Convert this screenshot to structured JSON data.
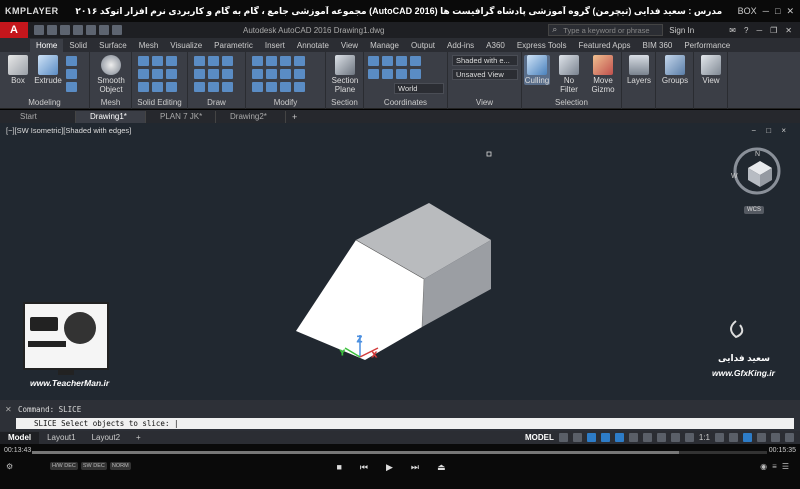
{
  "player": {
    "logo": "KMPLAYER",
    "title": "مجموعه آموزشی جامع ، گام به گام و کاربردی نرم افزار اتوکد ۲۰۱۶ (AutoCAD 2016)  مدرس : سعید فدایی (تیچرمن) گروه آموزشی پادشاه گرافیست ها",
    "right_label": "BOX",
    "time_elapsed": "00:13:43",
    "time_total": "00:15:35",
    "progress_fraction": 0.88,
    "badges": [
      "H/W DEC",
      "SW DEC",
      "NORM"
    ]
  },
  "acad": {
    "logo": "A",
    "filename": "Autodesk AutoCAD 2016    Drawing1.dwg",
    "search_placeholder": "Type a keyword or phrase",
    "signin": "Sign In"
  },
  "ribbon_tabs": [
    "Home",
    "Solid",
    "Surface",
    "Mesh",
    "Visualize",
    "Parametric",
    "Insert",
    "Annotate",
    "View",
    "Manage",
    "Output",
    "Add-ins",
    "A360",
    "Express Tools",
    "Featured Apps",
    "BIM 360",
    "Performance"
  ],
  "ribbon": {
    "panels": {
      "modeling": "Modeling",
      "mesh": "Mesh",
      "solid_editing": "Solid Editing",
      "draw": "Draw",
      "modify": "Modify",
      "section": "Section",
      "coordinates": "Coordinates",
      "view": "View",
      "selection": "Selection"
    },
    "buttons": {
      "box": "Box",
      "extrude": "Extrude",
      "smooth_object": "Smooth Object",
      "section_plane": "Section Plane",
      "culling": "Culling",
      "no_filter": "No Filter",
      "move_gizmo": "Move Gizmo",
      "layers": "Layers",
      "groups": "Groups",
      "view": "View"
    },
    "dropdowns": {
      "visual_style": "Shaded with e...",
      "saved_view": "Unsaved View",
      "ucs": "World"
    }
  },
  "file_tabs": [
    "Start",
    "Drawing1*",
    "PLAN 7 JK*",
    "Drawing2*"
  ],
  "viewport": {
    "label": "[−][SW Isometric][Shaded with edges]",
    "ctrls": "− □ ×",
    "viewcube_text": "WCS",
    "watermark_name": "www.TeacherMan.ir",
    "watermark_right_name": "سعید فدایی",
    "watermark_right_site": "www.GfxKing.ir",
    "colors": {
      "background": "#212830",
      "solid_top": "#b9bbbe",
      "solid_front": "#ffffff",
      "axis_x": "#d23c3c",
      "axis_y": "#3cc03c",
      "axis_z": "#4b8fe0"
    }
  },
  "command": {
    "history": "Command:  SLICE",
    "prompt": "SLICE Select objects to slice: |"
  },
  "layout_tabs": [
    "Model",
    "Layout1",
    "Layout2"
  ],
  "status": {
    "model": "MODEL",
    "scale": "1:1"
  }
}
